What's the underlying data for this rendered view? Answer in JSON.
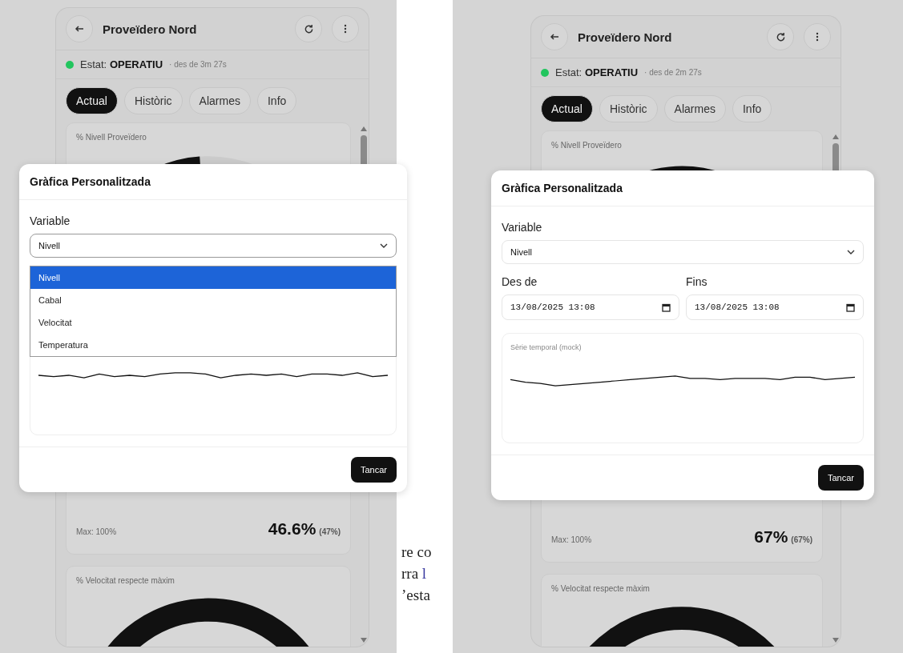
{
  "screens": [
    {
      "header": {
        "title": "Proveïdero Nord"
      },
      "status": {
        "color": "#22c55e",
        "label": "Estat:",
        "value": "OPERATIU",
        "since": "· des de 3m 27s"
      },
      "tabs": [
        {
          "label": "Actual",
          "selected": true
        },
        {
          "label": "Històric",
          "selected": false
        },
        {
          "label": "Alarmes",
          "selected": false
        },
        {
          "label": "Info",
          "selected": false
        }
      ],
      "gauges": [
        {
          "kind": "level",
          "title": "% Nivell Proveïdero",
          "level": 0.466,
          "max": "Max: 100%",
          "value": "46.6%",
          "rounded": "(47%)"
        },
        {
          "kind": "arc",
          "title": "% Velocitat respecte màxim"
        }
      ],
      "modal": {
        "title": "Gràfica Personalitzada",
        "variable_label": "Variable",
        "variable_value": "Nivell",
        "expanded": true,
        "options": [
          {
            "label": "Nivell",
            "selected": true
          },
          {
            "label": "Cabal",
            "selected": false
          },
          {
            "label": "Velocitat",
            "selected": false
          },
          {
            "label": "Temperatura",
            "selected": false
          }
        ],
        "close_button": "Tancar"
      }
    },
    {
      "header": {
        "title": "Proveïdero Nord"
      },
      "status": {
        "color": "#22c55e",
        "label": "Estat:",
        "value": "OPERATIU",
        "since": "· des de 2m 27s"
      },
      "tabs": [
        {
          "label": "Actual",
          "selected": true
        },
        {
          "label": "Històric",
          "selected": false
        },
        {
          "label": "Alarmes",
          "selected": false
        },
        {
          "label": "Info",
          "selected": false
        }
      ],
      "gauges": [
        {
          "kind": "level",
          "title": "% Nivell Proveïdero",
          "level": 0.67,
          "max": "Max: 100%",
          "value": "67%",
          "rounded": "(67%)"
        },
        {
          "kind": "arc",
          "title": "% Velocitat respecte màxim"
        }
      ],
      "modal": {
        "title": "Gràfica Personalitzada",
        "variable_label": "Variable",
        "variable_value": "Nivell",
        "expanded": false,
        "date_fields": [
          {
            "label": "Des de",
            "value": "13/08/2025 13:08"
          },
          {
            "label": "Fins",
            "value": "13/08/2025 13:08"
          }
        ],
        "chart_label": "Sèrie temporal (mock)",
        "close_button": "Tancar"
      }
    }
  ],
  "document_lines": [
    {
      "text": "re co"
    },
    {
      "text": "rra",
      "link": "l"
    },
    {
      "text": "’esta"
    }
  ]
}
